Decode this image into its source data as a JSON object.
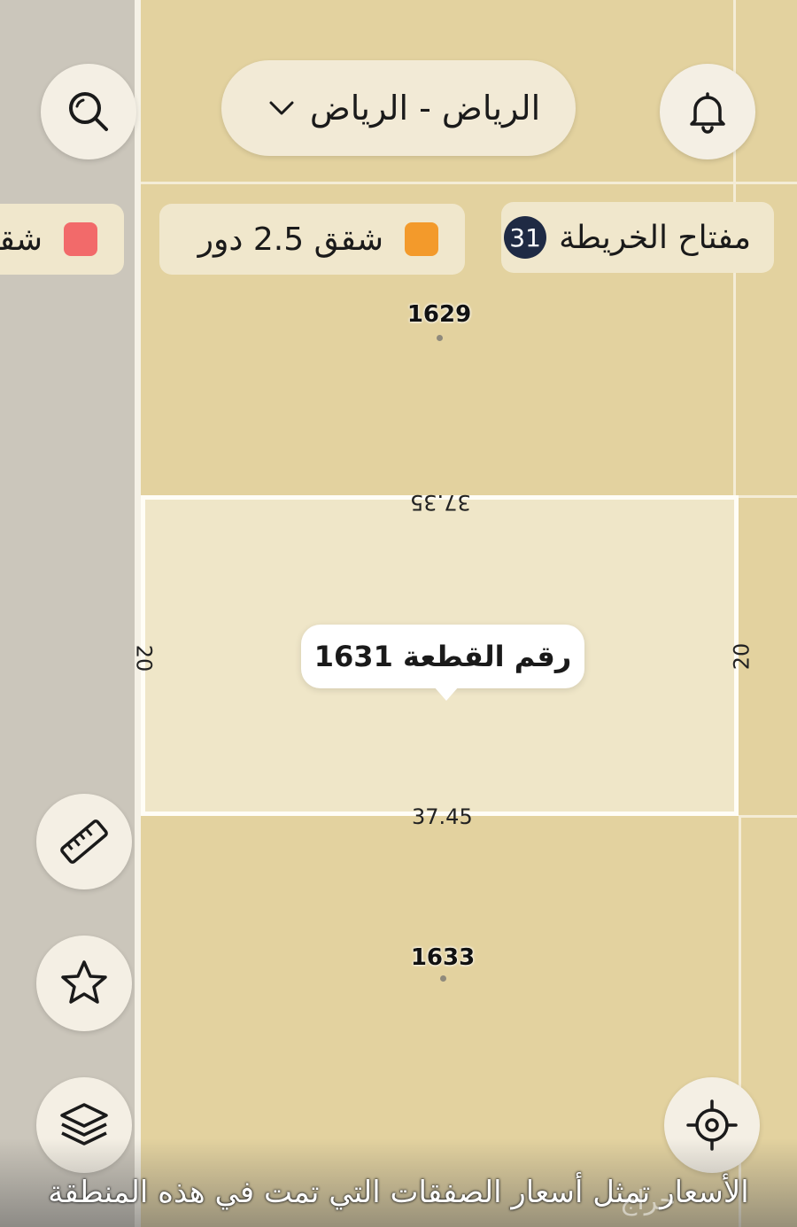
{
  "header": {
    "location_label": "الرياض  -  الرياض"
  },
  "buttons": {
    "search_icon": "search-icon",
    "bell_icon": "bell-icon",
    "ruler_icon": "ruler-icon",
    "star_icon": "star-icon",
    "layers_icon": "layers-icon",
    "locate_icon": "crosshair-icon"
  },
  "legend": {
    "key_label": "مفتاح الخريطة",
    "key_count": "31",
    "chips": [
      {
        "label": "شقق 2.5 دور",
        "color": "#f39a2b"
      },
      {
        "label": "شقق",
        "color": "#f26a6a"
      }
    ]
  },
  "map": {
    "plots": [
      {
        "number": "1629"
      },
      {
        "number": "1633"
      }
    ],
    "selected_plot": {
      "tooltip": "رقم القطعة 1631",
      "top_length": "37.35",
      "bottom_length": "37.45",
      "left_length": "20",
      "right_length": "20"
    }
  },
  "banner": {
    "text": "الأسعار تمثل أسعار الصفقات التي تمت في هذه المنطقة",
    "watermark": "حراج"
  }
}
